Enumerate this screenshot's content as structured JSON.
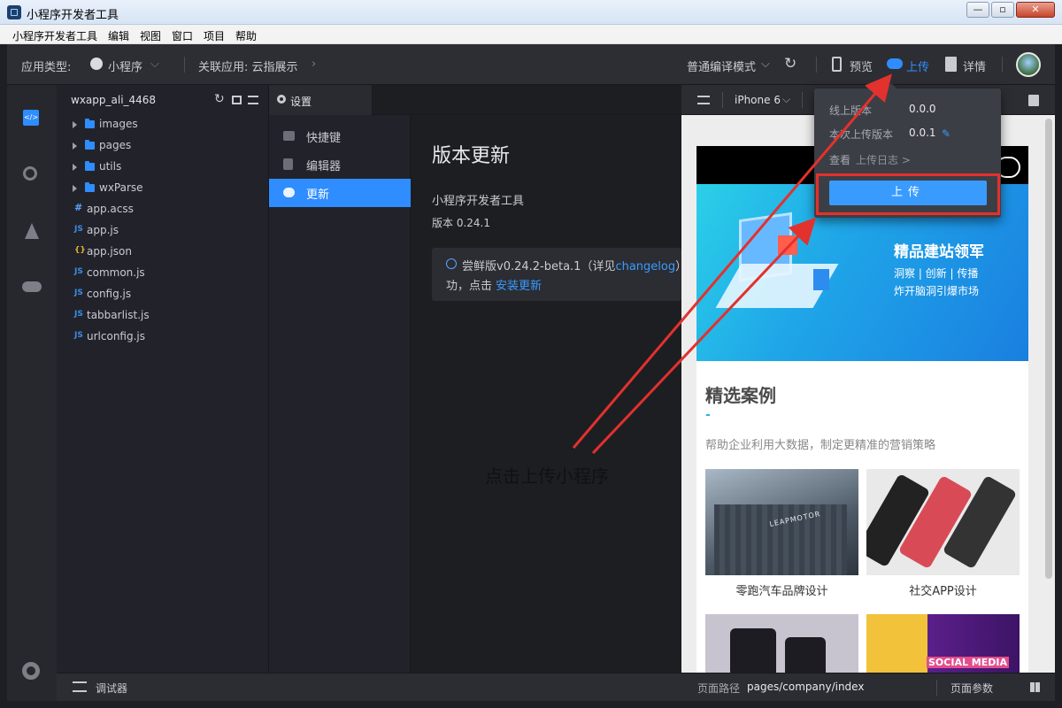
{
  "window": {
    "title": "小程序开发者工具",
    "minimize": "—",
    "restore": "▫",
    "close": "✕"
  },
  "menu": [
    "小程序开发者工具",
    "编辑",
    "视图",
    "窗口",
    "项目",
    "帮助"
  ],
  "toolbar": {
    "app_type_label": "应用类型:",
    "app_type_value": "小程序",
    "linked_app": "关联应用: 云指展示",
    "compile_mode": "普通编译模式",
    "preview": "预览",
    "upload": "上传",
    "details": "详情"
  },
  "filetree": {
    "project": "wxapp_ali_4468",
    "folders": [
      "images",
      "pages",
      "utils",
      "wxParse"
    ],
    "files": [
      {
        "type": "#",
        "name": "app.acss"
      },
      {
        "type": "JS",
        "name": "app.js"
      },
      {
        "type": "{}",
        "name": "app.json"
      },
      {
        "type": "JS",
        "name": "common.js"
      },
      {
        "type": "JS",
        "name": "config.js"
      },
      {
        "type": "JS",
        "name": "tabbarlist.js"
      },
      {
        "type": "JS",
        "name": "urlconfig.js"
      }
    ]
  },
  "tab": {
    "label": "设置"
  },
  "settings_nav": [
    "快捷键",
    "编辑器",
    "更新"
  ],
  "update_panel": {
    "heading": "版本更新",
    "product": "小程序开发者工具",
    "version": "版本 0.24.1",
    "notice_prefix": "尝鲜版v0.24.2-beta.1（详见",
    "notice_link": "changelog",
    "notice_mid": "）版",
    "notice_line2_prefix": "功，点击",
    "notice_line2_link": "安装更新"
  },
  "simulator": {
    "device": "iPhone 6",
    "banner_title": "精品建站领军",
    "banner_sub1": "洞察 | 创新 | 传播",
    "banner_sub2": "炸开脑洞引爆市场",
    "section_title": "精选案例",
    "section_dash": "-",
    "section_desc": "帮助企业利用大数据，制定更精准的营销策略",
    "cases": [
      {
        "label": "零跑汽车品牌设计",
        "brand": "LEAPMOTOR"
      },
      {
        "label": "社交APP设计"
      }
    ],
    "social_media": "SOCIAL MEDIA"
  },
  "popup": {
    "online_label": "线上版本",
    "online_value": "0.0.0",
    "upload_label": "本次上传版本",
    "upload_value": "0.0.1",
    "log_prefix": "查看",
    "log_link": "上传日志 >",
    "upload_button": "上传"
  },
  "statusbar": {
    "debugger": "调试器",
    "page_path_label": "页面路径",
    "page_path_value": "pages/company/index",
    "page_params": "页面参数"
  },
  "annotation": "点击上传小程序",
  "colors": {
    "accent": "#2f8dff",
    "annotation_red": "#e3312d"
  }
}
